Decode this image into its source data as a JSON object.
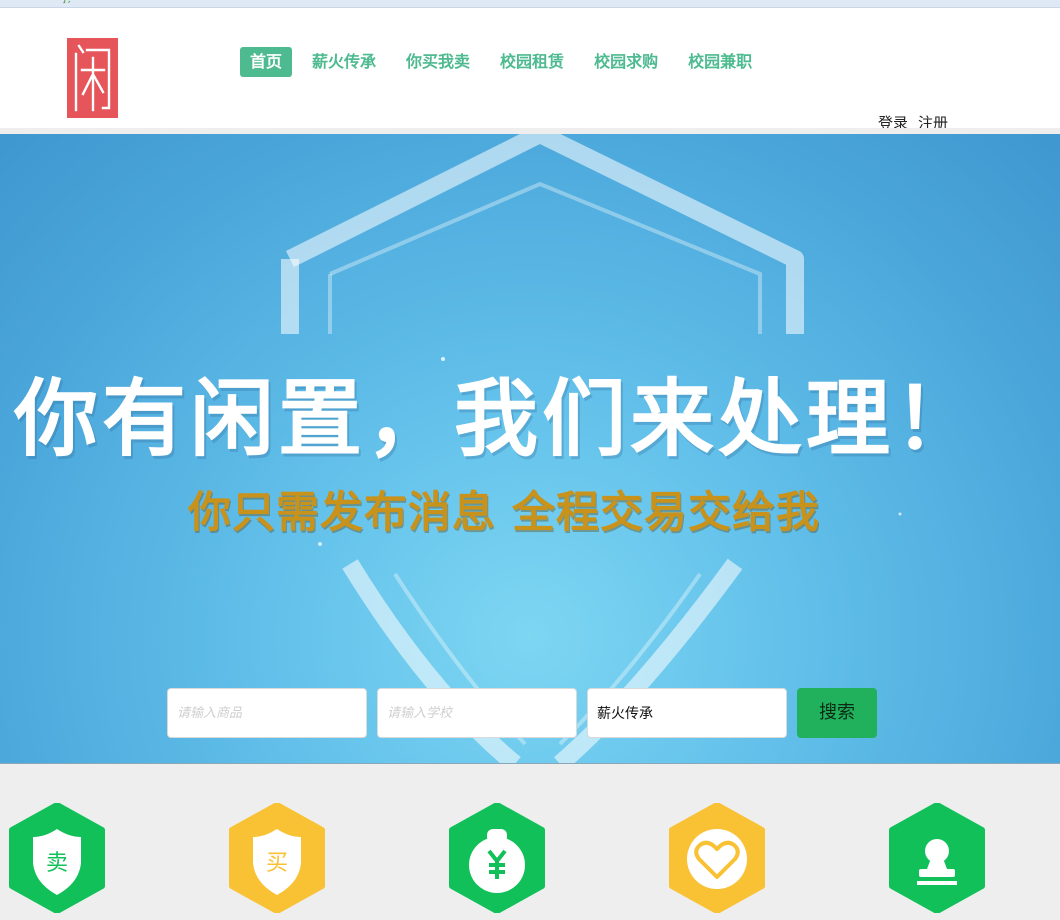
{
  "nav": {
    "items": [
      {
        "label": "首页",
        "active": true
      },
      {
        "label": "薪火传承",
        "active": false
      },
      {
        "label": "你买我卖",
        "active": false
      },
      {
        "label": "校园租赁",
        "active": false
      },
      {
        "label": "校园求购",
        "active": false
      },
      {
        "label": "校园兼职",
        "active": false
      }
    ]
  },
  "auth": {
    "login": "登录",
    "register": "注册"
  },
  "banner": {
    "headline": "你有闲置，我们来处理！",
    "subline": "你只需发布消息 全程交易交给我"
  },
  "search": {
    "product_placeholder": "请输入商品",
    "school_placeholder": "请输入学校",
    "category_value": "薪火传承",
    "button_label": "搜索"
  },
  "features": {
    "sell_label": "卖",
    "buy_label": "买",
    "rent_icon": "money-bag-icon",
    "wish_icon": "heart-icon",
    "job_icon": "stamp-icon"
  },
  "colors": {
    "accent": "#4dba8f",
    "logo": "#e6555a",
    "search_button": "#21b05b",
    "hex_green": "#12c05a",
    "hex_yellow": "#f9c234",
    "subline": "#c9921a"
  }
}
